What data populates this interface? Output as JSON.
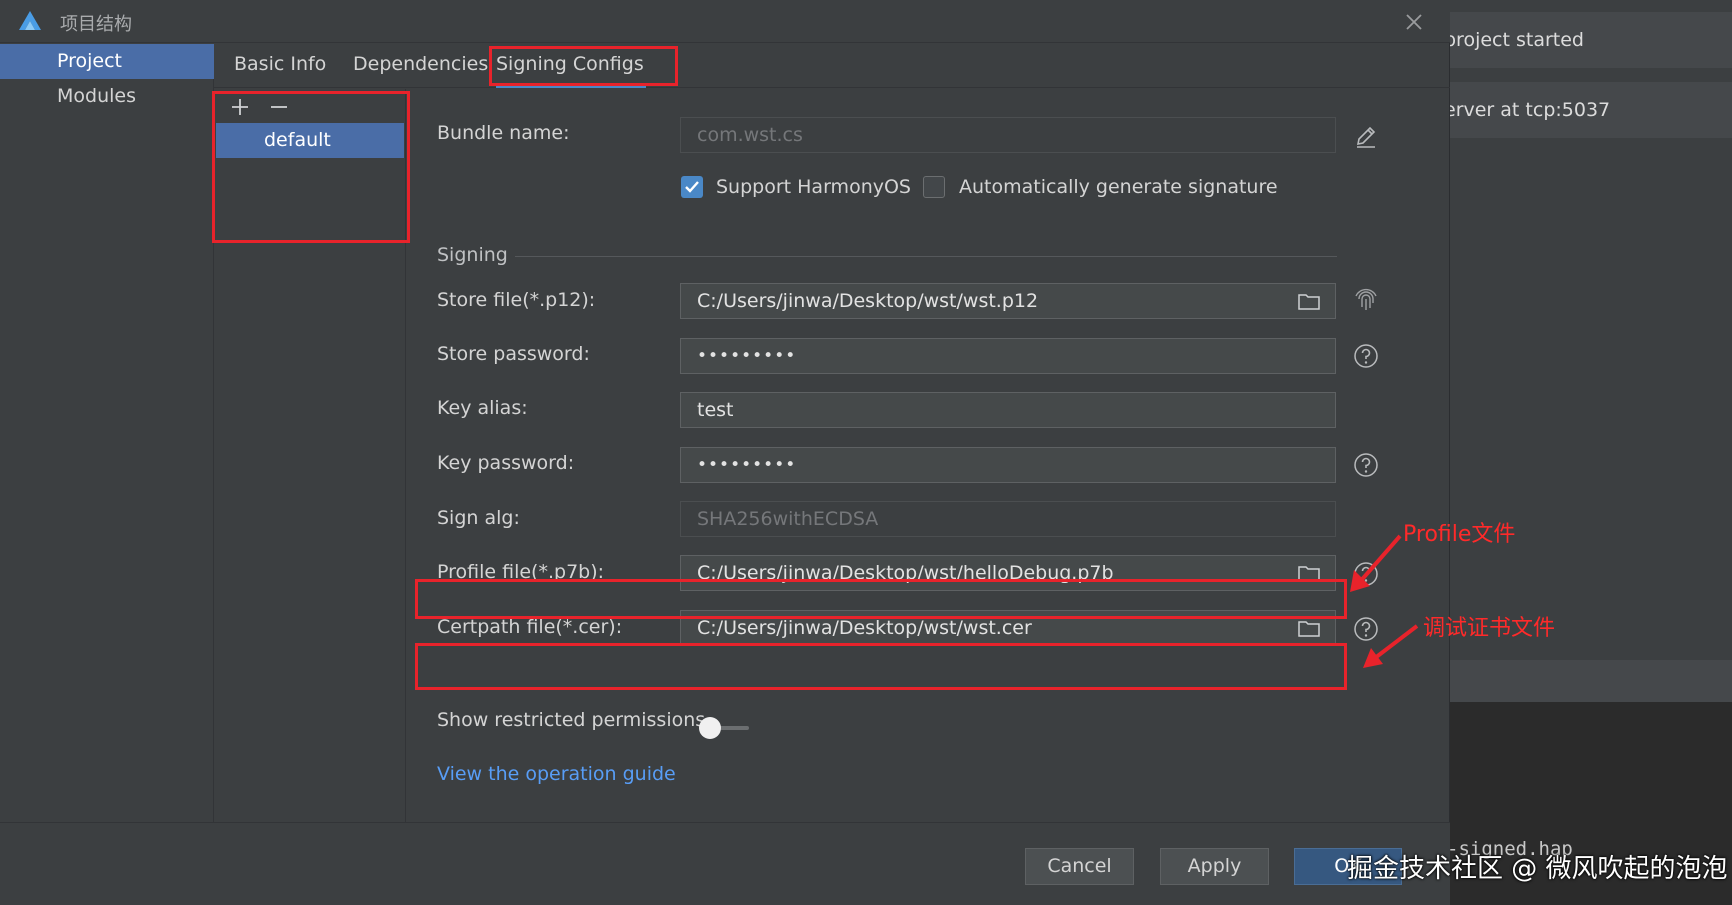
{
  "background": {
    "log_line_1": "project started",
    "log_line_2": "erver at tcp:5037",
    "terminal_text": "-signed.hap"
  },
  "dialog": {
    "title": "项目结构",
    "nav": [
      {
        "label": "Project",
        "active": true
      },
      {
        "label": "Modules",
        "active": false
      }
    ],
    "tabs": [
      {
        "label": "Basic Info",
        "active": false
      },
      {
        "label": "Dependencies",
        "active": false
      },
      {
        "label": "Signing Configs",
        "active": true
      }
    ],
    "config_list": {
      "add_icon": "plus-icon",
      "remove_icon": "minus-icon",
      "items": [
        "default"
      ]
    },
    "form": {
      "bundle_name": {
        "label": "Bundle name:",
        "value": "com.wst.cs"
      },
      "support_harmonyos": {
        "label": "Support HarmonyOS",
        "checked": true
      },
      "auto_signature": {
        "label": "Automatically generate signature",
        "checked": false
      },
      "signing_section": "Signing",
      "store_file": {
        "label": "Store file(*.p12):",
        "value": "C:/Users/jinwa/Desktop/wst/wst.p12"
      },
      "store_password": {
        "label": "Store password:",
        "value": "•••••••••"
      },
      "key_alias": {
        "label": "Key alias:",
        "value": "test"
      },
      "key_password": {
        "label": "Key password:",
        "value": "•••••••••"
      },
      "sign_alg": {
        "label": "Sign alg:",
        "value": "SHA256withECDSA"
      },
      "profile_file": {
        "label": "Profile file(*.p7b):",
        "value": "C:/Users/jinwa/Desktop/wst/helloDebug.p7b"
      },
      "certpath_file": {
        "label": "Certpath file(*.cer):",
        "value": "C:/Users/jinwa/Desktop/wst/wst.cer"
      },
      "show_restricted": {
        "label": "Show restricted permissions",
        "on": false
      },
      "guide_link": "View the operation guide"
    },
    "footer": {
      "cancel": "Cancel",
      "apply": "Apply",
      "ok": "OK"
    }
  },
  "annotations": {
    "profile_note": "Profile文件",
    "cert_note": "调试证书文件",
    "color": "#e8232b"
  },
  "watermark": "掘金技术社区 @ 微风吹起的泡泡",
  "colors": {
    "accent": "#4a6da7",
    "link": "#589df6",
    "checkbox": "#4a88c7"
  }
}
